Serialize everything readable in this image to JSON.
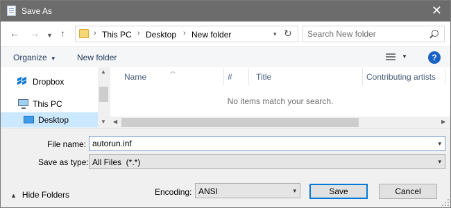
{
  "window": {
    "title": "Save As",
    "close_glyph": "✕"
  },
  "address": {
    "breadcrumb": [
      "This PC",
      "Desktop",
      "New folder"
    ],
    "search_placeholder": "Search New folder"
  },
  "toolbar": {
    "organize_label": "Organize",
    "new_folder_label": "New folder",
    "help_glyph": "?"
  },
  "nav_pane": {
    "items": [
      {
        "label": "Dropbox",
        "icon": "dropbox-icon"
      },
      {
        "label": "This PC",
        "icon": "computer-icon"
      },
      {
        "label": "Desktop",
        "icon": "desktop-icon",
        "selected": true
      }
    ]
  },
  "file_list": {
    "columns": [
      "Name",
      "#",
      "Title",
      "Contributing artists"
    ],
    "empty_message": "No items match your search."
  },
  "form": {
    "file_name_label": "File name:",
    "file_name_value": "autorun.inf",
    "save_as_type_label": "Save as type:",
    "save_as_type_value": "All Files  (*.*)",
    "encoding_label": "Encoding:",
    "encoding_value": "ANSI",
    "hide_folders_label": "Hide Folders",
    "save_label": "Save",
    "cancel_label": "Cancel"
  },
  "colors": {
    "titlebar": "#6c6c6c",
    "selection": "#cce8ff",
    "accent": "#0078d7",
    "help": "#1a63c6"
  }
}
